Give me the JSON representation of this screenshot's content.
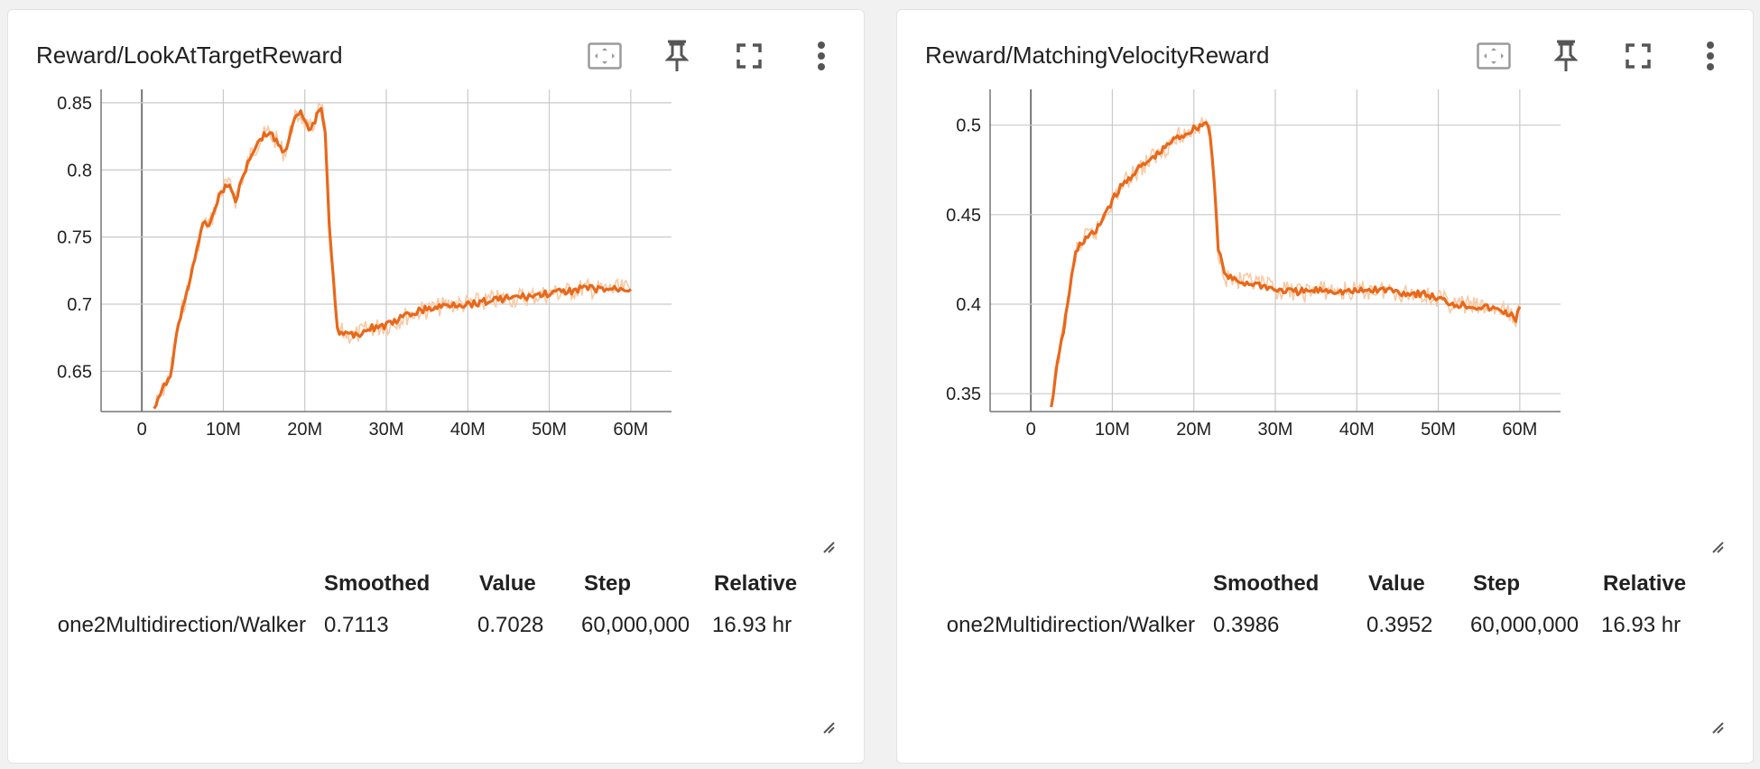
{
  "colors": {
    "series": "#e8681a",
    "series_raw": "#f8c9a4",
    "grid": "#c9c9c9",
    "axis": "#777777",
    "icon": "#555555"
  },
  "toolbar_icons": [
    "fit-domain-icon",
    "pin-icon",
    "fullscreen-icon",
    "more-vert-icon"
  ],
  "cards": [
    {
      "title": "Reward/LookAtTargetReward",
      "table": {
        "headers": [
          "Smoothed",
          "Value",
          "Step",
          "Relative"
        ],
        "row": {
          "run": "one2Multidirection/Walker",
          "smoothed": "0.7113",
          "value": "0.7028",
          "step": "60,000,000",
          "relative": "16.93 hr"
        }
      }
    },
    {
      "title": "Reward/MatchingVelocityReward",
      "table": {
        "headers": [
          "Smoothed",
          "Value",
          "Step",
          "Relative"
        ],
        "row": {
          "run": "one2Multidirection/Walker",
          "smoothed": "0.3986",
          "value": "0.3952",
          "step": "60,000,000",
          "relative": "16.93 hr"
        }
      }
    }
  ],
  "chart_data": [
    {
      "type": "line",
      "title": "Reward/LookAtTargetReward",
      "x_unit": "steps (M)",
      "xlim": [
        -5,
        65
      ],
      "ylim": [
        0.62,
        0.86
      ],
      "x_ticks": [
        0,
        10,
        20,
        30,
        40,
        50,
        60
      ],
      "x_tick_labels": [
        "0",
        "10M",
        "20M",
        "30M",
        "40M",
        "50M",
        "60M"
      ],
      "y_ticks": [
        0.65,
        0.7,
        0.75,
        0.8,
        0.85
      ],
      "y_tick_labels": [
        "0.65",
        "0.7",
        "0.75",
        "0.8",
        "0.85"
      ],
      "grid": true,
      "series": [
        {
          "x": [
            1.5,
            2.5,
            3.5,
            4.5,
            5.5,
            6.5,
            7.5,
            8.5,
            9.5,
            10.5,
            11.5,
            12.5,
            13.5,
            14.5,
            15.5,
            16.5,
            17.5,
            18.5,
            19.5,
            20.5,
            21.5,
            22.0,
            22.5,
            23.0,
            24,
            26,
            28,
            30,
            32,
            34,
            36,
            38,
            40,
            42,
            44,
            46,
            48,
            50,
            52,
            54,
            56,
            58,
            60
          ],
          "y": [
            0.622,
            0.635,
            0.648,
            0.685,
            0.708,
            0.735,
            0.758,
            0.762,
            0.782,
            0.79,
            0.778,
            0.797,
            0.813,
            0.823,
            0.828,
            0.822,
            0.812,
            0.835,
            0.842,
            0.828,
            0.84,
            0.848,
            0.83,
            0.76,
            0.68,
            0.676,
            0.682,
            0.684,
            0.69,
            0.695,
            0.697,
            0.7,
            0.7,
            0.702,
            0.704,
            0.705,
            0.706,
            0.708,
            0.709,
            0.712,
            0.711,
            0.711,
            0.7113
          ]
        }
      ]
    },
    {
      "type": "line",
      "title": "Reward/MatchingVelocityReward",
      "x_unit": "steps (M)",
      "xlim": [
        -5,
        65
      ],
      "ylim": [
        0.34,
        0.52
      ],
      "x_ticks": [
        0,
        10,
        20,
        30,
        40,
        50,
        60
      ],
      "x_tick_labels": [
        "0",
        "10M",
        "20M",
        "30M",
        "40M",
        "50M",
        "60M"
      ],
      "y_ticks": [
        0.35,
        0.4,
        0.45,
        0.5
      ],
      "y_tick_labels": [
        "0.35",
        "0.4",
        "0.45",
        "0.5"
      ],
      "grid": true,
      "series": [
        {
          "x": [
            2.5,
            3.0,
            3.5,
            4.0,
            4.5,
            5.0,
            5.5,
            6.0,
            7.0,
            8.0,
            9.0,
            10.0,
            11.0,
            12.0,
            13.0,
            14.0,
            15.0,
            16.0,
            17.0,
            18.0,
            19.0,
            20.0,
            21.0,
            21.5,
            22.0,
            22.5,
            23.0,
            24,
            26,
            28,
            30,
            32,
            34,
            36,
            38,
            40,
            42,
            44,
            46,
            48,
            50,
            52,
            54,
            56,
            58,
            59.5,
            60
          ],
          "y": [
            0.341,
            0.36,
            0.372,
            0.385,
            0.4,
            0.415,
            0.428,
            0.433,
            0.438,
            0.44,
            0.45,
            0.458,
            0.465,
            0.47,
            0.475,
            0.478,
            0.482,
            0.485,
            0.49,
            0.493,
            0.495,
            0.498,
            0.5,
            0.502,
            0.495,
            0.47,
            0.43,
            0.415,
            0.412,
            0.411,
            0.408,
            0.407,
            0.407,
            0.408,
            0.407,
            0.407,
            0.408,
            0.408,
            0.406,
            0.406,
            0.403,
            0.4,
            0.399,
            0.398,
            0.396,
            0.392,
            0.3986
          ]
        }
      ]
    }
  ]
}
